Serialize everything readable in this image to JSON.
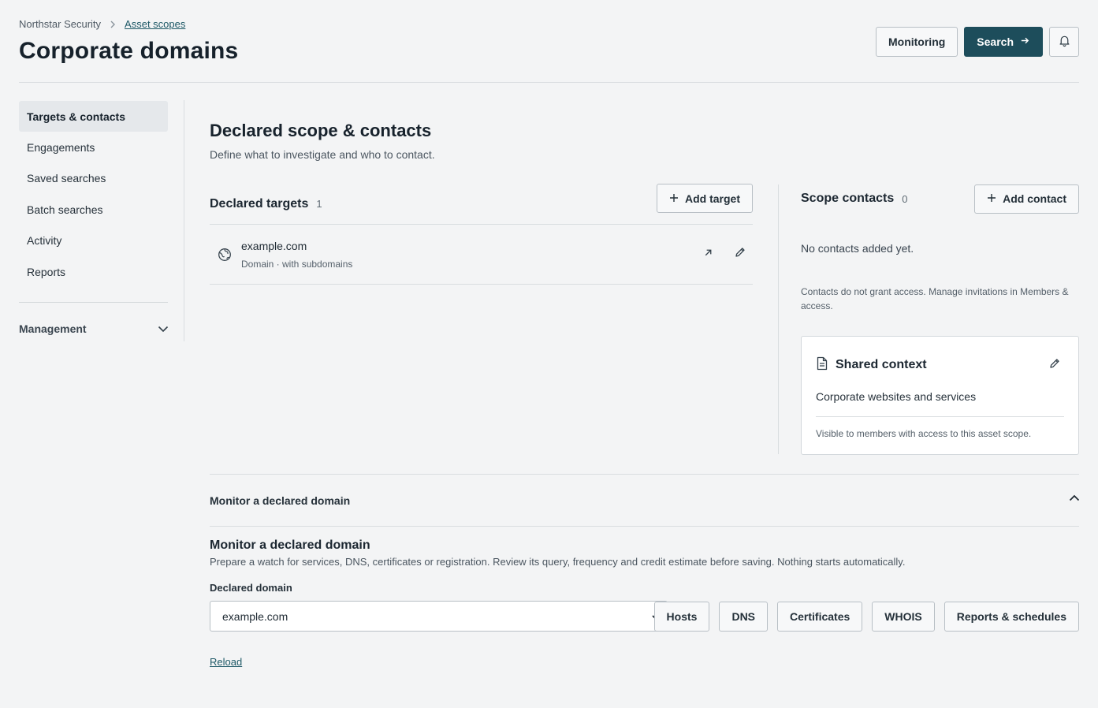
{
  "header": {
    "breadcrumb": {
      "root": "Northstar Security",
      "current": "Asset scopes"
    },
    "title": "Corporate domains",
    "actions": {
      "monitoring": "Monitoring",
      "search": "Search"
    }
  },
  "sidebar": {
    "items": [
      {
        "label": "Targets & contacts"
      },
      {
        "label": "Engagements"
      },
      {
        "label": "Saved searches"
      },
      {
        "label": "Batch searches"
      },
      {
        "label": "Activity"
      },
      {
        "label": "Reports"
      }
    ],
    "management": "Management"
  },
  "main": {
    "title": "Declared scope & contacts",
    "description": "Define what to investigate and who to contact.",
    "targets": {
      "title": "Declared targets",
      "count": "1",
      "add_label": "Add target",
      "rows": [
        {
          "name": "example.com",
          "meta": "Domain · with subdomains"
        }
      ]
    },
    "contacts": {
      "title": "Scope contacts",
      "count": "0",
      "add_label": "Add contact",
      "empty": "No contacts added yet.",
      "note": "Contacts do not grant access. Manage invitations in Members & access."
    },
    "shared_context": {
      "title": "Shared context",
      "body": "Corporate websites and services",
      "footer": "Visible to members with access to this asset scope."
    },
    "accordion": {
      "label": "Monitor a declared domain"
    },
    "monitor": {
      "title": "Monitor a declared domain",
      "description": "Prepare a watch for services, DNS, certificates or registration. Review its query, frequency and credit estimate before saving. Nothing starts automatically.",
      "field_label": "Declared domain",
      "selected": "example.com",
      "chips": [
        "Hosts",
        "DNS",
        "Certificates",
        "WHOIS",
        "Reports & schedules"
      ],
      "reload": "Reload"
    }
  },
  "colors": {
    "primary": "#1d4d5b",
    "link": "#1d5866",
    "background": "#f3f4f5"
  }
}
